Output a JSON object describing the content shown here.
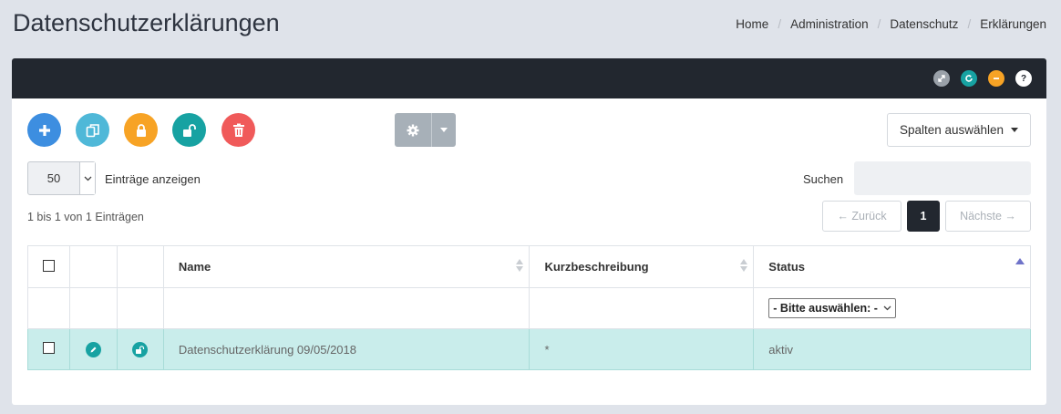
{
  "page": {
    "title": "Datenschutzerklärungen"
  },
  "breadcrumb": [
    "Home",
    "Administration",
    "Datenschutz",
    "Erklärungen"
  ],
  "header_tools": [
    {
      "icon": "expand-icon",
      "color": "#9aa1a9"
    },
    {
      "icon": "refresh-icon",
      "color": "#17a2a2"
    },
    {
      "icon": "collapse-icon",
      "color": "#f7a325"
    },
    {
      "icon": "help-icon",
      "color": "#ffffff",
      "glyph": "?"
    }
  ],
  "toolbar": {
    "buttons": [
      {
        "icon": "add-icon",
        "color": "#3d8ee0"
      },
      {
        "icon": "copy-icon",
        "color": "#4fb8d8"
      },
      {
        "icon": "lock-icon",
        "color": "#f7a325"
      },
      {
        "icon": "unlock-icon",
        "color": "#17a2a2"
      },
      {
        "icon": "delete-icon",
        "color": "#f05a5a"
      }
    ],
    "settings_icon": "gear-icon",
    "columns_button": "Spalten auswählen"
  },
  "length": {
    "value": "50",
    "label": "Einträge anzeigen"
  },
  "search": {
    "label": "Suchen",
    "value": ""
  },
  "info": "1 bis 1 von 1 Einträgen",
  "pagination": {
    "prev": "← Zurück",
    "current": "1",
    "next": "Nächste →"
  },
  "table": {
    "headers": {
      "name": "Name",
      "short": "Kurzbeschreibung",
      "status": "Status"
    },
    "status_filter": "- Bitte auswählen: -",
    "rows": [
      {
        "name": "Datenschutzerklärung 09/05/2018",
        "short": "*",
        "status": "aktiv"
      }
    ]
  },
  "colors": {
    "accent": "#17a2a2",
    "header_bg": "#22272f",
    "row_highlight": "#c9edeb"
  }
}
